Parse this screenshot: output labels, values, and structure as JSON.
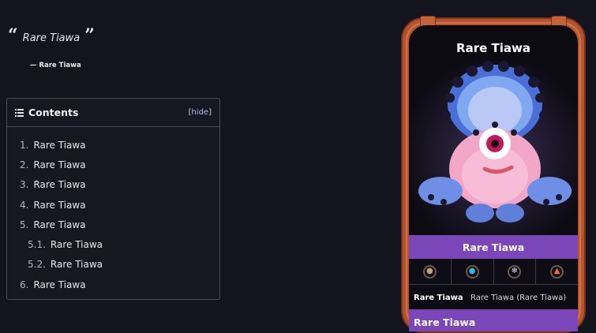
{
  "quote": {
    "text": "Rare Tiawa",
    "cite": "— Rare Tiawa"
  },
  "toc": {
    "title": "Contents",
    "hide_label": "hide",
    "items": [
      {
        "num": "1.",
        "label": "Rare Tiawa"
      },
      {
        "num": "2.",
        "label": "Rare Tiawa"
      },
      {
        "num": "3.",
        "label": "Rare Tiawa"
      },
      {
        "num": "4.",
        "label": "Rare Tiawa"
      },
      {
        "num": "5.",
        "label": "Rare Tiawa"
      },
      {
        "num": "5.1.",
        "label": "Rare Tiawa"
      },
      {
        "num": "5.2.",
        "label": "Rare Tiawa"
      },
      {
        "num": "6.",
        "label": "Rare Tiawa"
      }
    ]
  },
  "infobox": {
    "title": "Rare Tiawa",
    "name_bar": "Rare Tiawa",
    "elements": [
      "earth-icon",
      "water-icon",
      "cold-icon",
      "fire-icon"
    ],
    "row": {
      "key": "Rare Tiawa",
      "value": "Rare Tiawa (Rare Tiawa)"
    },
    "section": "Rare Tiawa",
    "accent": "#7a46b8",
    "frame": "#b6532c"
  }
}
